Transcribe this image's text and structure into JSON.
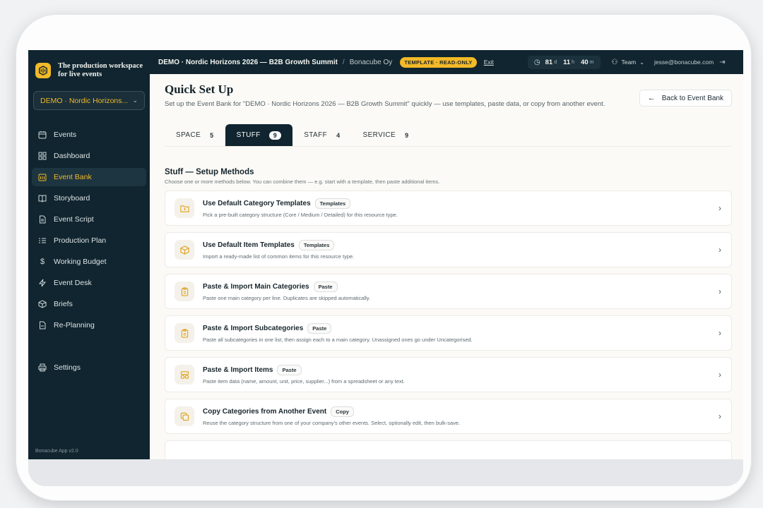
{
  "brand": {
    "name": "The production workspace for live events"
  },
  "sidebar": {
    "event_select": "DEMO · Nordic Horizons...",
    "items": [
      {
        "label": "Events",
        "icon": "calendar-icon"
      },
      {
        "label": "Dashboard",
        "icon": "dashboard-icon"
      },
      {
        "label": "Event Bank",
        "icon": "bank-icon",
        "active": true
      },
      {
        "label": "Storyboard",
        "icon": "book-icon"
      },
      {
        "label": "Event Script",
        "icon": "script-icon"
      },
      {
        "label": "Production Plan",
        "icon": "list-icon"
      },
      {
        "label": "Working Budget",
        "icon": "dollar-icon"
      },
      {
        "label": "Event Desk",
        "icon": "bolt-icon"
      },
      {
        "label": "Briefs",
        "icon": "box-icon"
      },
      {
        "label": "Re-Planning",
        "icon": "document-icon"
      }
    ],
    "settings_label": "Settings",
    "version": "Bonacube App v2.0"
  },
  "topbar": {
    "event_title": "DEMO · Nordic Horizons 2026 — B2B Growth Summit",
    "separator": "/",
    "org": "Bonacube Oy",
    "badge": "TEMPLATE · READ-ONLY",
    "exit": "Exit",
    "countdown": {
      "days": "81",
      "days_unit": "d",
      "hours": "11",
      "hours_unit": "h",
      "minutes": "40",
      "minutes_unit": "m"
    },
    "team": "Team",
    "email": "jesse@bonacube.com"
  },
  "page": {
    "title": "Quick Set Up",
    "subtitle": "Set up the Event Bank for \"DEMO · Nordic Horizons 2026 — B2B Growth Summit\" quickly — use templates, paste data, or copy from another event.",
    "back_button": "Back to Event Bank"
  },
  "tabs": [
    {
      "label": "SPACE",
      "count": "5"
    },
    {
      "label": "STUFF",
      "count": "9",
      "active": true
    },
    {
      "label": "STAFF",
      "count": "4"
    },
    {
      "label": "SERVICE",
      "count": "9"
    }
  ],
  "section": {
    "title": "Stuff — Setup Methods",
    "subtitle": "Choose one or more methods below. You can combine them — e.g. start with a template, then paste additional items."
  },
  "methods": [
    {
      "title": "Use Default Category Templates",
      "tag": "Templates",
      "desc": "Pick a pre-built category structure (Core / Medium / Detailed) for this resource type.",
      "icon": "folder-icon"
    },
    {
      "title": "Use Default Item Templates",
      "tag": "Templates",
      "desc": "Import a ready-made list of common items for this resource type.",
      "icon": "package-icon"
    },
    {
      "title": "Paste & Import Main Categories",
      "tag": "Paste",
      "desc": "Paste one main category per line. Duplicates are skipped automatically.",
      "icon": "clipboard-icon"
    },
    {
      "title": "Paste & Import Subcategories",
      "tag": "Paste",
      "desc": "Paste all subcategories in one list, then assign each to a main category. Unassigned ones go under Uncategorised.",
      "icon": "clipboard-icon"
    },
    {
      "title": "Paste & Import Items",
      "tag": "Paste",
      "desc": "Paste item data (name, amount, unit, price, supplier...) from a spreadsheet or any text.",
      "icon": "layout-icon"
    },
    {
      "title": "Copy Categories from Another Event",
      "tag": "Copy",
      "desc": "Reuse the category structure from one of your company's other events. Select, optionally edit, then bulk-save.",
      "icon": "copy-icon"
    }
  ],
  "colors": {
    "accent": "#f2b928",
    "sidebar_bg": "#10252f",
    "page_bg": "#fbfaf6"
  }
}
